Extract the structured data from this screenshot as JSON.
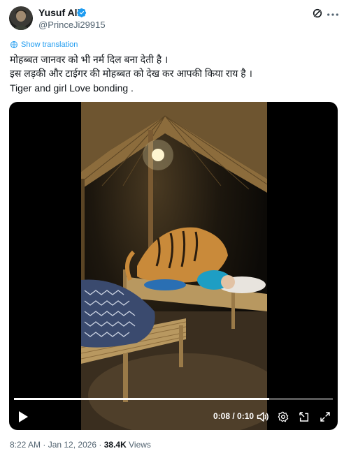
{
  "author": {
    "name": "Yusuf Ali",
    "handle": "@PrinceJi29915"
  },
  "actions": {
    "grok_icon": "grok-icon",
    "more_icon": "more-icon"
  },
  "translation": {
    "label": "Show translation"
  },
  "tweet": {
    "lines": [
      "मोहब्बत जानवर को भी नर्म दिल बना देती है ।",
      "इस लड़की और टाईगर की मोहब्बत को देख कर आपकी किया राय है ।",
      "Tiger and girl Love bonding ."
    ]
  },
  "video": {
    "time": "0:08 / 0:10",
    "progress": 0.8,
    "controls": [
      "play-icon",
      "volume-icon",
      "settings-icon",
      "popout-icon",
      "fullscreen-icon"
    ]
  },
  "meta": {
    "timestamp": "8:22 AM · Jan 12, 2026 · ",
    "views_count": "38.4K",
    "views_label": " Views"
  },
  "colors": {
    "accent": "#1d9bf0",
    "text": "#0f1419",
    "muted": "#536471"
  }
}
